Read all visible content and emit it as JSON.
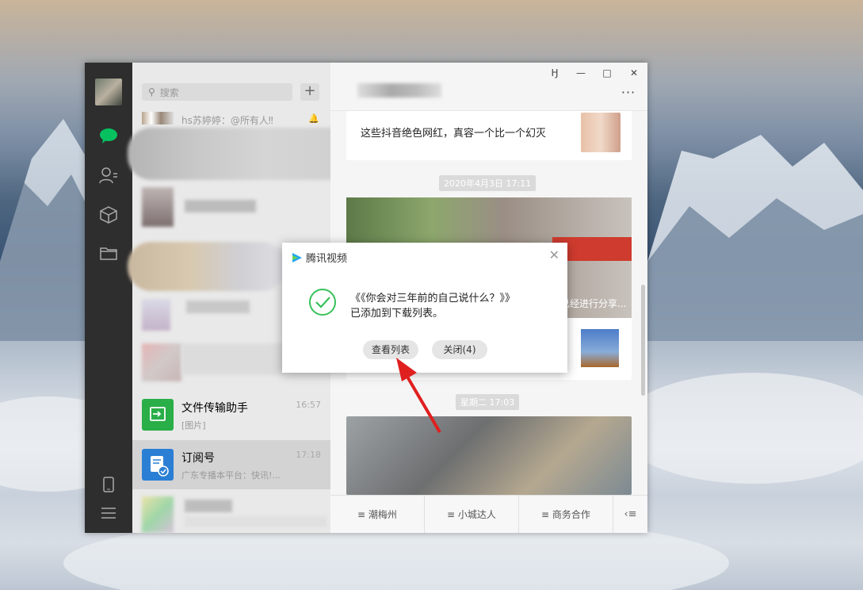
{
  "search": {
    "placeholder": "搜索"
  },
  "chats": [
    {
      "name": "hs苏婷婷：@所有人‼",
      "preview": "",
      "time": ""
    },
    {
      "name": "文件传输助手",
      "preview": "[图片]",
      "time": "16:57"
    },
    {
      "name": "订阅号",
      "preview": "广东专播本平台：快讯!...",
      "time": "17:18"
    }
  ],
  "messages": {
    "article1": "这些抖音绝色网红，真容一个比一个幻灭",
    "time1": "2020年4月3日 17:11",
    "article2_caption": "已经进行分享...",
    "time2": "星期二 17:03"
  },
  "bottom_menu": [
    "潮梅州",
    "小城达人",
    "商务合作"
  ],
  "dialog": {
    "app": "腾讯视频",
    "title": "《《你会对三年前的自己说什么？》》",
    "subtitle": "已添加到下载列表。",
    "view_btn": "查看列表",
    "close_btn": "关闭(4)"
  },
  "colors": {
    "wechat_green": "#07c160",
    "file_helper": "#2aae48",
    "subscription": "#2a7fd4"
  }
}
